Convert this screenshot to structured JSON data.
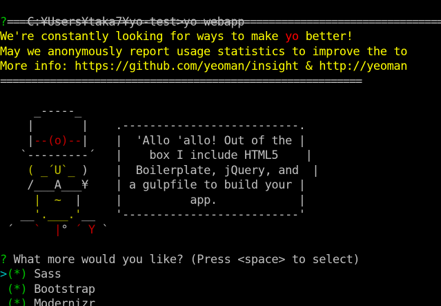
{
  "prompt_line": "C:¥Users¥taka7¥yo-test>yo webapp",
  "insight": {
    "q_mark": "?",
    "separator": "==========================================================================",
    "line1_a": "We're constantly looking for ways to make ",
    "line1_yo": "yo",
    "line1_b": " better!",
    "line2": "May we anonymously report usage statistics to improve the to",
    "line3": "More info: https://github.com/yeoman/insight & http://yeoman",
    "separator_end": "=========================================================="
  },
  "ascii_art": {
    "row1": "     _-----_",
    "row2": "    |       |    .--------------------------.",
    "row3_a": "    |",
    "row3_b": "--(o)--",
    "row3_c": "|    |  'Allo 'allo! Out of the |",
    "row4": "   `---------´   |    box I include HTML5    |",
    "row5_a": "    ( ",
    "row5_b": "_´U`_",
    "row5_c": " )    |  Boilerplate, jQuery, and  |",
    "row6_a": "    /",
    "row6_b": "___A___",
    "row6_c": "¥    | a gulpfile to build your |",
    "row7_a": "     |",
    "row7_b": "  ~  ",
    "row7_c": "|     |          app.            |",
    "row8_a": "   __",
    "row8_b": "'.___.'",
    "row8_c": "__   '--------------------------'",
    "row9_a": " ´   ",
    "row9_b": "`  |",
    "row9_c": "° ",
    "row9_d": "´ Y",
    "row9_e": " `"
  },
  "question": {
    "q_mark": "?",
    "text": " What more would you like?",
    "hint": " (Press <space> to select)"
  },
  "options": [
    {
      "pointer": ">",
      "check": "(*)",
      "label": "Sass"
    },
    {
      "pointer": " ",
      "check": "(*)",
      "label": "Bootstrap"
    },
    {
      "pointer": " ",
      "check": "(*)",
      "label": "Modernizr"
    }
  ]
}
